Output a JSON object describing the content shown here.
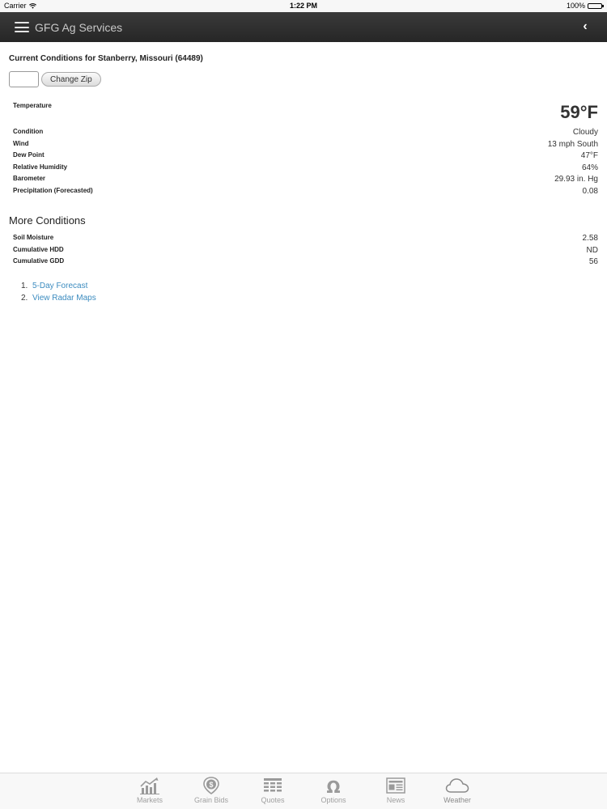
{
  "status_bar": {
    "carrier": "Carrier",
    "time": "1:22 PM",
    "battery": "100%"
  },
  "header": {
    "title": "GFG Ag Services",
    "menu_icon": "hamburger-menu-icon",
    "back_icon": "chevron-left-icon",
    "back_glyph": "‹"
  },
  "current_conditions": {
    "title": "Current Conditions for Stanberry, Missouri (64489)",
    "zip_value": "",
    "change_zip_label": "Change Zip",
    "temperature_label": "Temperature",
    "temperature_value": "59°F",
    "rows": [
      {
        "label": "Condition",
        "value": "Cloudy"
      },
      {
        "label": "Wind",
        "value": "13 mph South"
      },
      {
        "label": "Dew Point",
        "value": "47°F"
      },
      {
        "label": "Relative Humidity",
        "value": "64%"
      },
      {
        "label": "Barometer",
        "value": "29.93 in. Hg"
      },
      {
        "label": "Precipitation (Forecasted)",
        "value": "0.08"
      }
    ]
  },
  "more_conditions": {
    "title": "More Conditions",
    "rows": [
      {
        "label": "Soil Moisture",
        "value": "2.58"
      },
      {
        "label": "Cumulative HDD",
        "value": "ND"
      },
      {
        "label": "Cumulative GDD",
        "value": "56"
      }
    ]
  },
  "links": [
    {
      "number": "1.",
      "label": "5-Day Forecast"
    },
    {
      "number": "2.",
      "label": "View Radar Maps"
    }
  ],
  "tabs": [
    {
      "label": "Markets",
      "icon": "chart-icon"
    },
    {
      "label": "Grain Bids",
      "icon": "dollar-badge-icon"
    },
    {
      "label": "Quotes",
      "icon": "grid-table-icon"
    },
    {
      "label": "Options",
      "icon": "omega-icon"
    },
    {
      "label": "News",
      "icon": "newspaper-icon"
    },
    {
      "label": "Weather",
      "icon": "cloud-icon"
    }
  ],
  "active_tab": "Weather",
  "colors": {
    "header_bg": "#2d2d2d",
    "link": "#3b8bbf",
    "tab_icon": "#9a9a9a"
  }
}
